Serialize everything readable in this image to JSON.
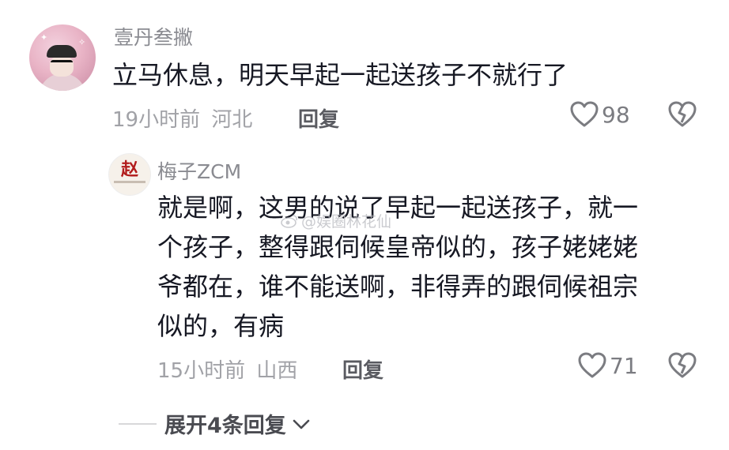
{
  "comment": {
    "username": "壹丹叁撇",
    "content": "立马休息，明天早起一起送孩子不就行了",
    "time": "19小时前",
    "location": "河北",
    "reply_label": "回复",
    "likes": "98"
  },
  "reply": {
    "username": "梅子ZCM",
    "content_lines": [
      "就是啊，这男的说了早起一起送孩子，就一",
      "个孩子，整得跟伺候皇帝似的，孩子姥姥姥",
      "爷都在，谁不能送啊，非得弄的跟伺候祖宗",
      "似的，有病"
    ],
    "time": "15小时前",
    "location": "山西",
    "reply_label": "回复",
    "likes": "71",
    "avatar_glyph": "赵"
  },
  "expand_label": "展开4条回复",
  "watermark": "@娱圈林花仙",
  "icons": {
    "like": "heart-outline-icon",
    "dislike": "broken-heart-icon",
    "expand": "chevron-down-icon",
    "watermark": "weibo-icon"
  }
}
